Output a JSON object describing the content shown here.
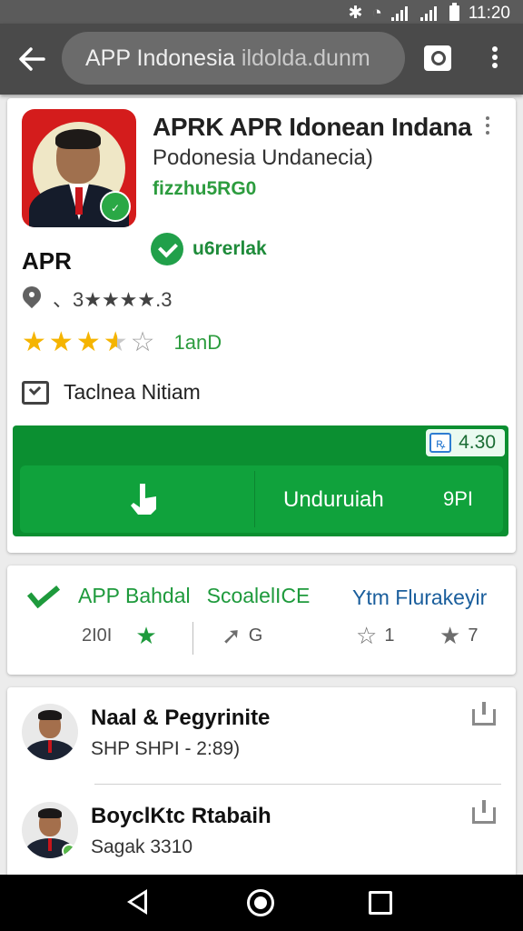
{
  "status_bar": {
    "time": "11:20",
    "icons": [
      "mute-icon",
      "wifi-icon",
      "signal-icon",
      "signal-icon",
      "battery-icon"
    ]
  },
  "toolbar": {
    "url_text": "APP Indonesia",
    "url_host": "ildolda.dunm",
    "back_icon": "back-arrow-icon",
    "tabs_icon": "tabs-icon",
    "menu_icon": "overflow-menu-icon"
  },
  "app": {
    "title": "APRK APR Idonean Indana",
    "subtitle": "Podonesia Undanecia)",
    "developer": "fizzhu5RG0",
    "short_name": "APR",
    "verified_label": "u6rerlak",
    "location_text": "、3★★★★.3",
    "rating": {
      "full": 3,
      "half": 1,
      "empty": 1,
      "value_label": "1anD"
    },
    "category": "Taclnea Nitiam",
    "price_chip": "4.30",
    "install_label": "Unduruiah",
    "install_size": "9PI",
    "accent_color": "#0b8f31"
  },
  "stats": {
    "left_label": "APP Bahdal",
    "mid_label": "ScoalelICE",
    "right_label": "Ytm Flurakeyir",
    "cells": [
      {
        "value": "2I0I"
      },
      {
        "value": "G"
      },
      {
        "value": "1"
      },
      {
        "value": "7"
      }
    ]
  },
  "reviews": [
    {
      "name": "Naal & Pegyrinite",
      "meta": "SHP SHPI - 2:89)"
    },
    {
      "name": "BoyclKtc Rtabaih",
      "meta": "Sagak 3310"
    }
  ]
}
